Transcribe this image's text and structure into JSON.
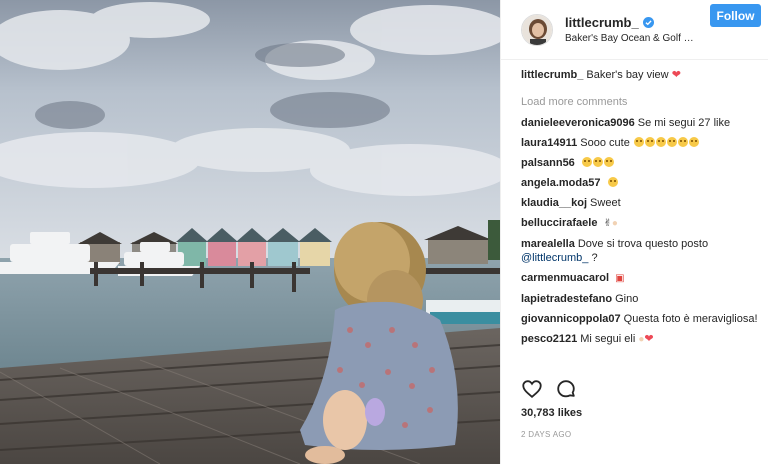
{
  "post": {
    "username": "littlecrumb_",
    "verified": true,
    "location": "Baker's Bay Ocean & Golf C...",
    "follow_label": "Follow",
    "caption_user": "littlecrumb_",
    "caption_text": "Baker's bay view",
    "load_more": "Load more comments",
    "likes": "30,783 likes",
    "time": "2 DAYS AGO"
  },
  "comments": [
    {
      "user": "danieleeveronica9096",
      "text": "Se mi segui 27 like"
    },
    {
      "user": "laura14911",
      "text": "Sooo cute"
    },
    {
      "user": "palsann56",
      "text": ""
    },
    {
      "user": "angela.moda57",
      "text": ""
    },
    {
      "user": "klaudia__koj",
      "text": "Sweet"
    },
    {
      "user": "belluccirafaele",
      "text": ""
    },
    {
      "user": "marealella",
      "text": "Dove si trova questo posto",
      "mention": "@littlecrumb_",
      "tail": " ?"
    },
    {
      "user": "carmenmuacarol",
      "text": ""
    },
    {
      "user": "lapietradestefano",
      "text": "Gino"
    },
    {
      "user": "giovannicoppola07",
      "text": "Questa foto è meravigliosa!"
    },
    {
      "user": "pesco2121",
      "text": "Mi segui eli"
    }
  ],
  "icons": {
    "verified": "verified-badge-icon",
    "like": "heart-outline-icon",
    "comment": "speech-bubble-icon"
  },
  "colors": {
    "follow_button": "#3897f0",
    "verified": "#3897f0",
    "heart": "#ed4956",
    "muted_text": "#999999"
  }
}
